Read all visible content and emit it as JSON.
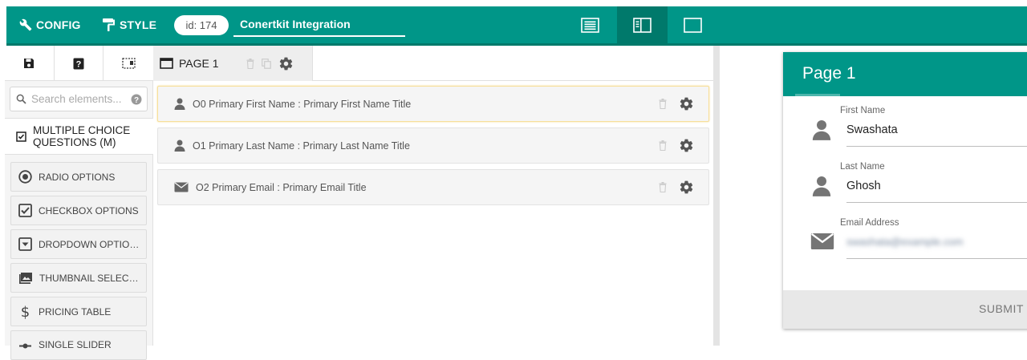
{
  "toolbar": {
    "config_label": "CONFIG",
    "style_label": "STYLE",
    "form_id": "id: 174",
    "form_title": "Conertkit Integration"
  },
  "colors": {
    "primary": "#009688",
    "primary_dark": "#00796b",
    "selected_border": "#f7df9a"
  },
  "left_panel": {
    "icons": [
      "save-icon",
      "help-icon",
      "layout-icon"
    ],
    "search_placeholder": "Search elements...",
    "category": "MULTIPLE CHOICE QUESTIONS (M)",
    "elements": [
      {
        "label": "RADIO OPTIONS",
        "icon": "radio-icon"
      },
      {
        "label": "CHECKBOX OPTIONS",
        "icon": "checkbox-icon"
      },
      {
        "label": "DROPDOWN OPTIONS",
        "icon": "dropdown-icon"
      },
      {
        "label": "THUMBNAIL SELECTI...",
        "icon": "image-icon"
      },
      {
        "label": "PRICING TABLE",
        "icon": "dollar-icon"
      },
      {
        "label": "SINGLE SLIDER",
        "icon": "slider-icon"
      }
    ]
  },
  "builder": {
    "page_tab": "PAGE 1",
    "rows": [
      {
        "label": "O0 Primary First Name : Primary First Name Title",
        "icon": "person-icon",
        "selected": true
      },
      {
        "label": "O1 Primary Last Name : Primary Last Name Title",
        "icon": "person-icon",
        "selected": false
      },
      {
        "label": "O2 Primary Email : Primary Email Title",
        "icon": "email-icon",
        "selected": false
      }
    ]
  },
  "preview": {
    "page_title": "Page 1",
    "fields": [
      {
        "label": "First Name",
        "value": "Swashata",
        "icon": "person-icon"
      },
      {
        "label": "Last Name",
        "value": "Ghosh",
        "icon": "person-icon"
      },
      {
        "label": "Email Address",
        "value": "swashata@example.com",
        "icon": "email-icon"
      }
    ],
    "submit_label": "SUBMIT"
  }
}
